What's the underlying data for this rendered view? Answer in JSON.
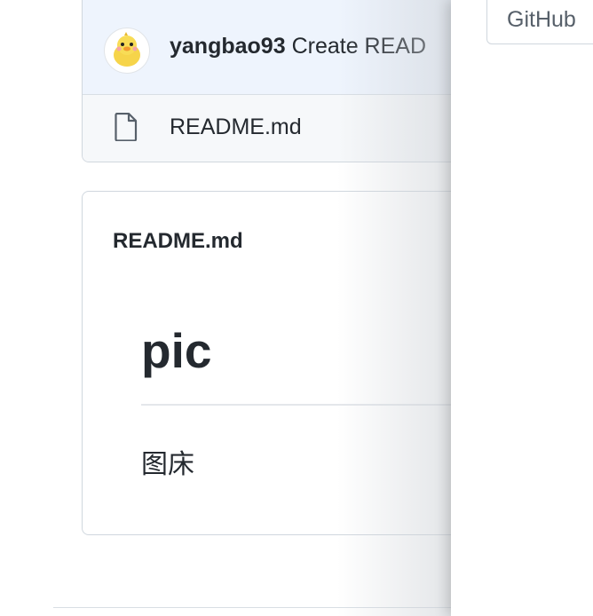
{
  "commit": {
    "author": "yangbao93",
    "message": "Create READ"
  },
  "files": [
    {
      "name": "README.md",
      "icon": "file-icon"
    }
  ],
  "readme": {
    "header": "README.md",
    "h1": "pic",
    "paragraph": "图床"
  },
  "overlay": {
    "button_label": "GitHub"
  },
  "colors": {
    "commit_bg": "#eef4fd",
    "file_row_bg": "#f6f8fa",
    "border": "#d0d7de",
    "text": "#24292f"
  }
}
